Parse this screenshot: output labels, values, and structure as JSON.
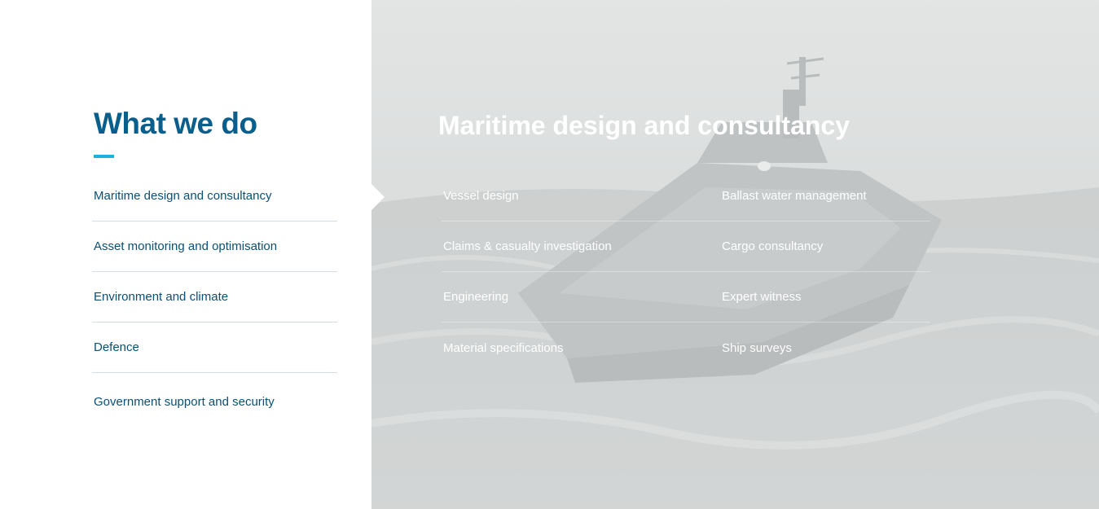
{
  "left": {
    "heading": "What we do",
    "nav_items": [
      "Maritime design and consultancy",
      "Asset monitoring and optimisation",
      "Environment and climate",
      "Defence",
      "Government support and security"
    ]
  },
  "panel": {
    "title": "Maritime design and consultancy",
    "services": [
      "Vessel design",
      "Ballast water management",
      "Claims & casualty investigation",
      "Cargo consultancy",
      "Engineering",
      "Expert witness",
      "Material specifications",
      "Ship surveys"
    ]
  },
  "colors": {
    "heading": "#0a5e8c",
    "accent": "#19b3de",
    "nav_text": "#0b4f74"
  },
  "background_image": "unmanned-vessel-at-sea"
}
